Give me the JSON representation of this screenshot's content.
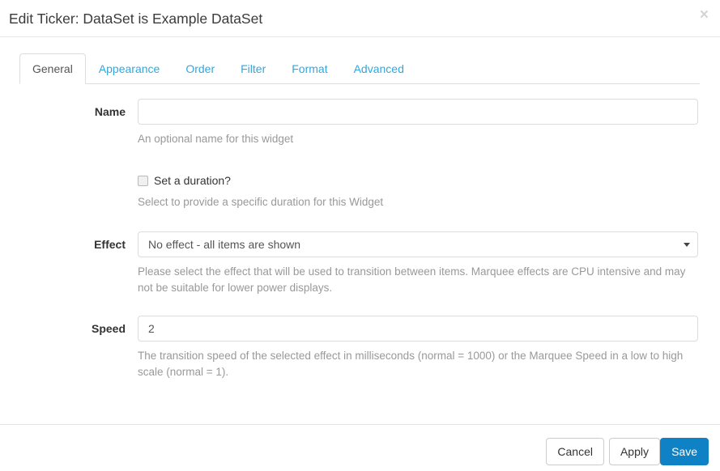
{
  "window": {
    "title": "Edit Ticker: DataSet is Example DataSet",
    "close_label": "×",
    "close_icon": "close-icon"
  },
  "tabs": [
    {
      "label": "General",
      "active": true
    },
    {
      "label": "Appearance",
      "active": false
    },
    {
      "label": "Order",
      "active": false
    },
    {
      "label": "Filter",
      "active": false
    },
    {
      "label": "Format",
      "active": false
    },
    {
      "label": "Advanced",
      "active": false
    }
  ],
  "form": {
    "name": {
      "label": "Name",
      "value": "",
      "placeholder": "",
      "help": "An optional name for this widget"
    },
    "duration": {
      "checkbox_label": "Set a duration?",
      "checked": false,
      "help": "Select to provide a specific duration for this Widget"
    },
    "effect": {
      "label": "Effect",
      "selected": "No effect - all items are shown",
      "caret_icon": "chevron-down-icon",
      "help": "Please select the effect that will be used to transition between items. Marquee effects are CPU intensive and may not be suitable for lower power displays."
    },
    "speed": {
      "label": "Speed",
      "value": "2",
      "placeholder": "",
      "help": "The transition speed of the selected effect in milliseconds (normal = 1000) or the Marquee Speed in a low to high scale (normal = 1)."
    }
  },
  "footer": {
    "cancel_label": "Cancel",
    "apply_label": "Apply",
    "save_label": "Save"
  },
  "colors": {
    "link_blue": "#31a7dd",
    "primary_blue": "#0e82c4",
    "border_gray": "#dddddd",
    "help_gray": "#999999"
  }
}
